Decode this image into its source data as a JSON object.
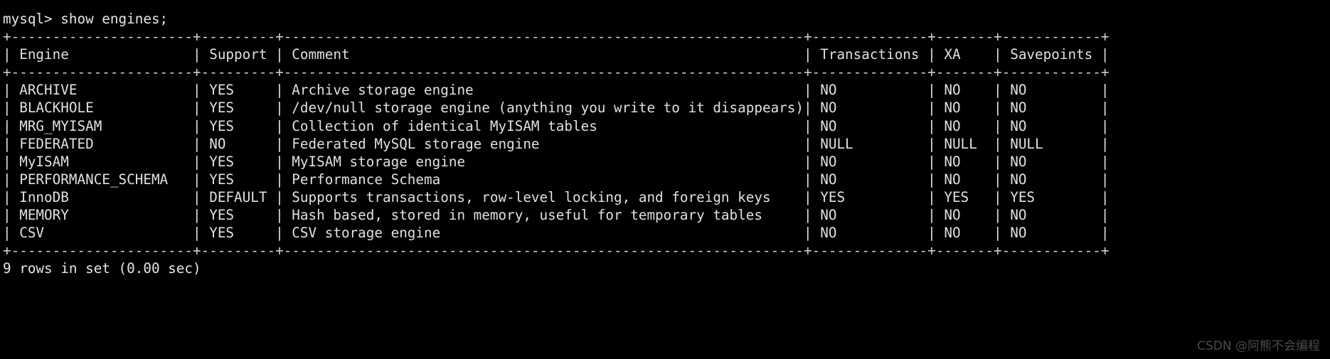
{
  "terminal": {
    "prompt": "mysql>",
    "command": "show engines;",
    "prompt_line": "mysql> show engines;",
    "status_line": "9 rows in set (0.00 sec)",
    "row_count": 9,
    "duration": "0.00 sec",
    "background_color": "#000000",
    "text_color": "#d8d8d8"
  },
  "watermark": {
    "text": "CSDN @阿熊不会编程",
    "color": "#4a4a4a"
  },
  "table": {
    "columns": [
      {
        "name": "Engine",
        "width": 22
      },
      {
        "name": "Support",
        "width": 9
      },
      {
        "name": "Comment",
        "width": 63
      },
      {
        "name": "Transactions",
        "width": 14
      },
      {
        "name": "XA",
        "width": 7
      },
      {
        "name": "Savepoints",
        "width": 12
      }
    ],
    "headers": [
      "Engine",
      "Support",
      "Comment",
      "Transactions",
      "XA",
      "Savepoints"
    ],
    "rows": [
      {
        "Engine": "ARCHIVE",
        "Support": "YES",
        "Comment": "Archive storage engine",
        "Transactions": "NO",
        "XA": "NO",
        "Savepoints": "NO"
      },
      {
        "Engine": "BLACKHOLE",
        "Support": "YES",
        "Comment": "/dev/null storage engine (anything you write to it disappears)",
        "Transactions": "NO",
        "XA": "NO",
        "Savepoints": "NO"
      },
      {
        "Engine": "MRG_MYISAM",
        "Support": "YES",
        "Comment": "Collection of identical MyISAM tables",
        "Transactions": "NO",
        "XA": "NO",
        "Savepoints": "NO"
      },
      {
        "Engine": "FEDERATED",
        "Support": "NO",
        "Comment": "Federated MySQL storage engine",
        "Transactions": "NULL",
        "XA": "NULL",
        "Savepoints": "NULL"
      },
      {
        "Engine": "MyISAM",
        "Support": "YES",
        "Comment": "MyISAM storage engine",
        "Transactions": "NO",
        "XA": "NO",
        "Savepoints": "NO"
      },
      {
        "Engine": "PERFORMANCE_SCHEMA",
        "Support": "YES",
        "Comment": "Performance Schema",
        "Transactions": "NO",
        "XA": "NO",
        "Savepoints": "NO"
      },
      {
        "Engine": "InnoDB",
        "Support": "DEFAULT",
        "Comment": "Supports transactions, row-level locking, and foreign keys",
        "Transactions": "YES",
        "XA": "YES",
        "Savepoints": "YES"
      },
      {
        "Engine": "MEMORY",
        "Support": "YES",
        "Comment": "Hash based, stored in memory, useful for temporary tables",
        "Transactions": "NO",
        "XA": "NO",
        "Savepoints": "NO"
      },
      {
        "Engine": "CSV",
        "Support": "YES",
        "Comment": "CSV storage engine",
        "Transactions": "NO",
        "XA": "NO",
        "Savepoints": "NO"
      }
    ]
  }
}
